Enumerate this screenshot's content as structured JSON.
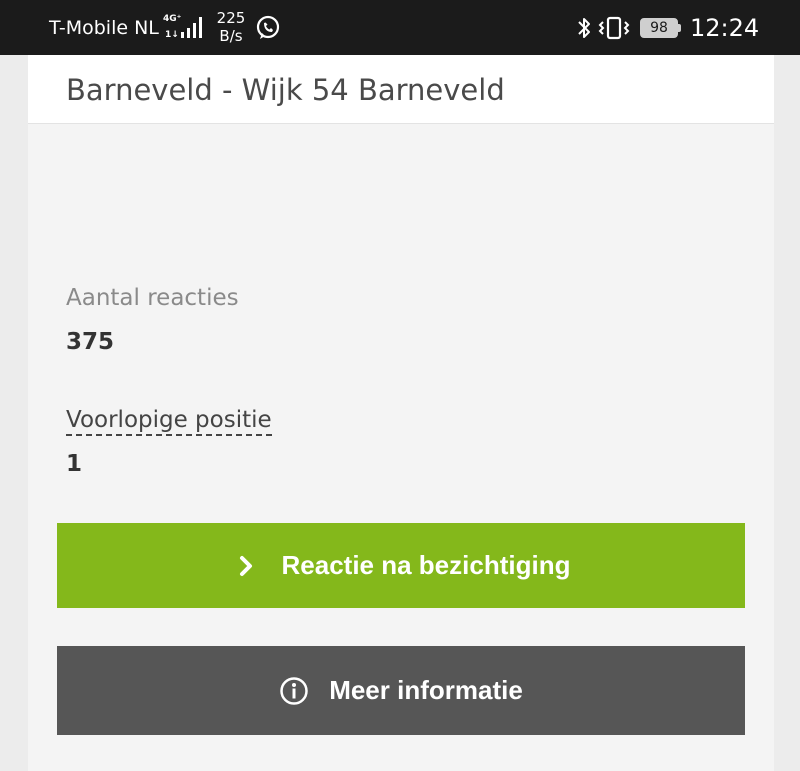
{
  "status_bar": {
    "carrier": "T-Mobile  NL",
    "network_type": "4G⁺",
    "network_sub": "1↓",
    "speed_value": "225",
    "speed_unit": "B/s",
    "battery": "98",
    "clock": "12:24",
    "icons": [
      "signal-icon",
      "whatsapp-icon",
      "bluetooth-icon",
      "vibrate-icon",
      "battery-icon"
    ]
  },
  "header": {
    "title": "Barneveld - Wijk 54 Barneveld"
  },
  "details": {
    "responses_label": "Aantal reacties",
    "responses_value": "375",
    "position_label": "Voorlopige positie",
    "position_value": "1"
  },
  "actions": {
    "primary_label": "Reactie na bezichtiging",
    "secondary_label": "Meer informatie"
  },
  "colors": {
    "primary": "#84b81b",
    "secondary": "#565656",
    "status_bar": "#1b1b1b"
  }
}
